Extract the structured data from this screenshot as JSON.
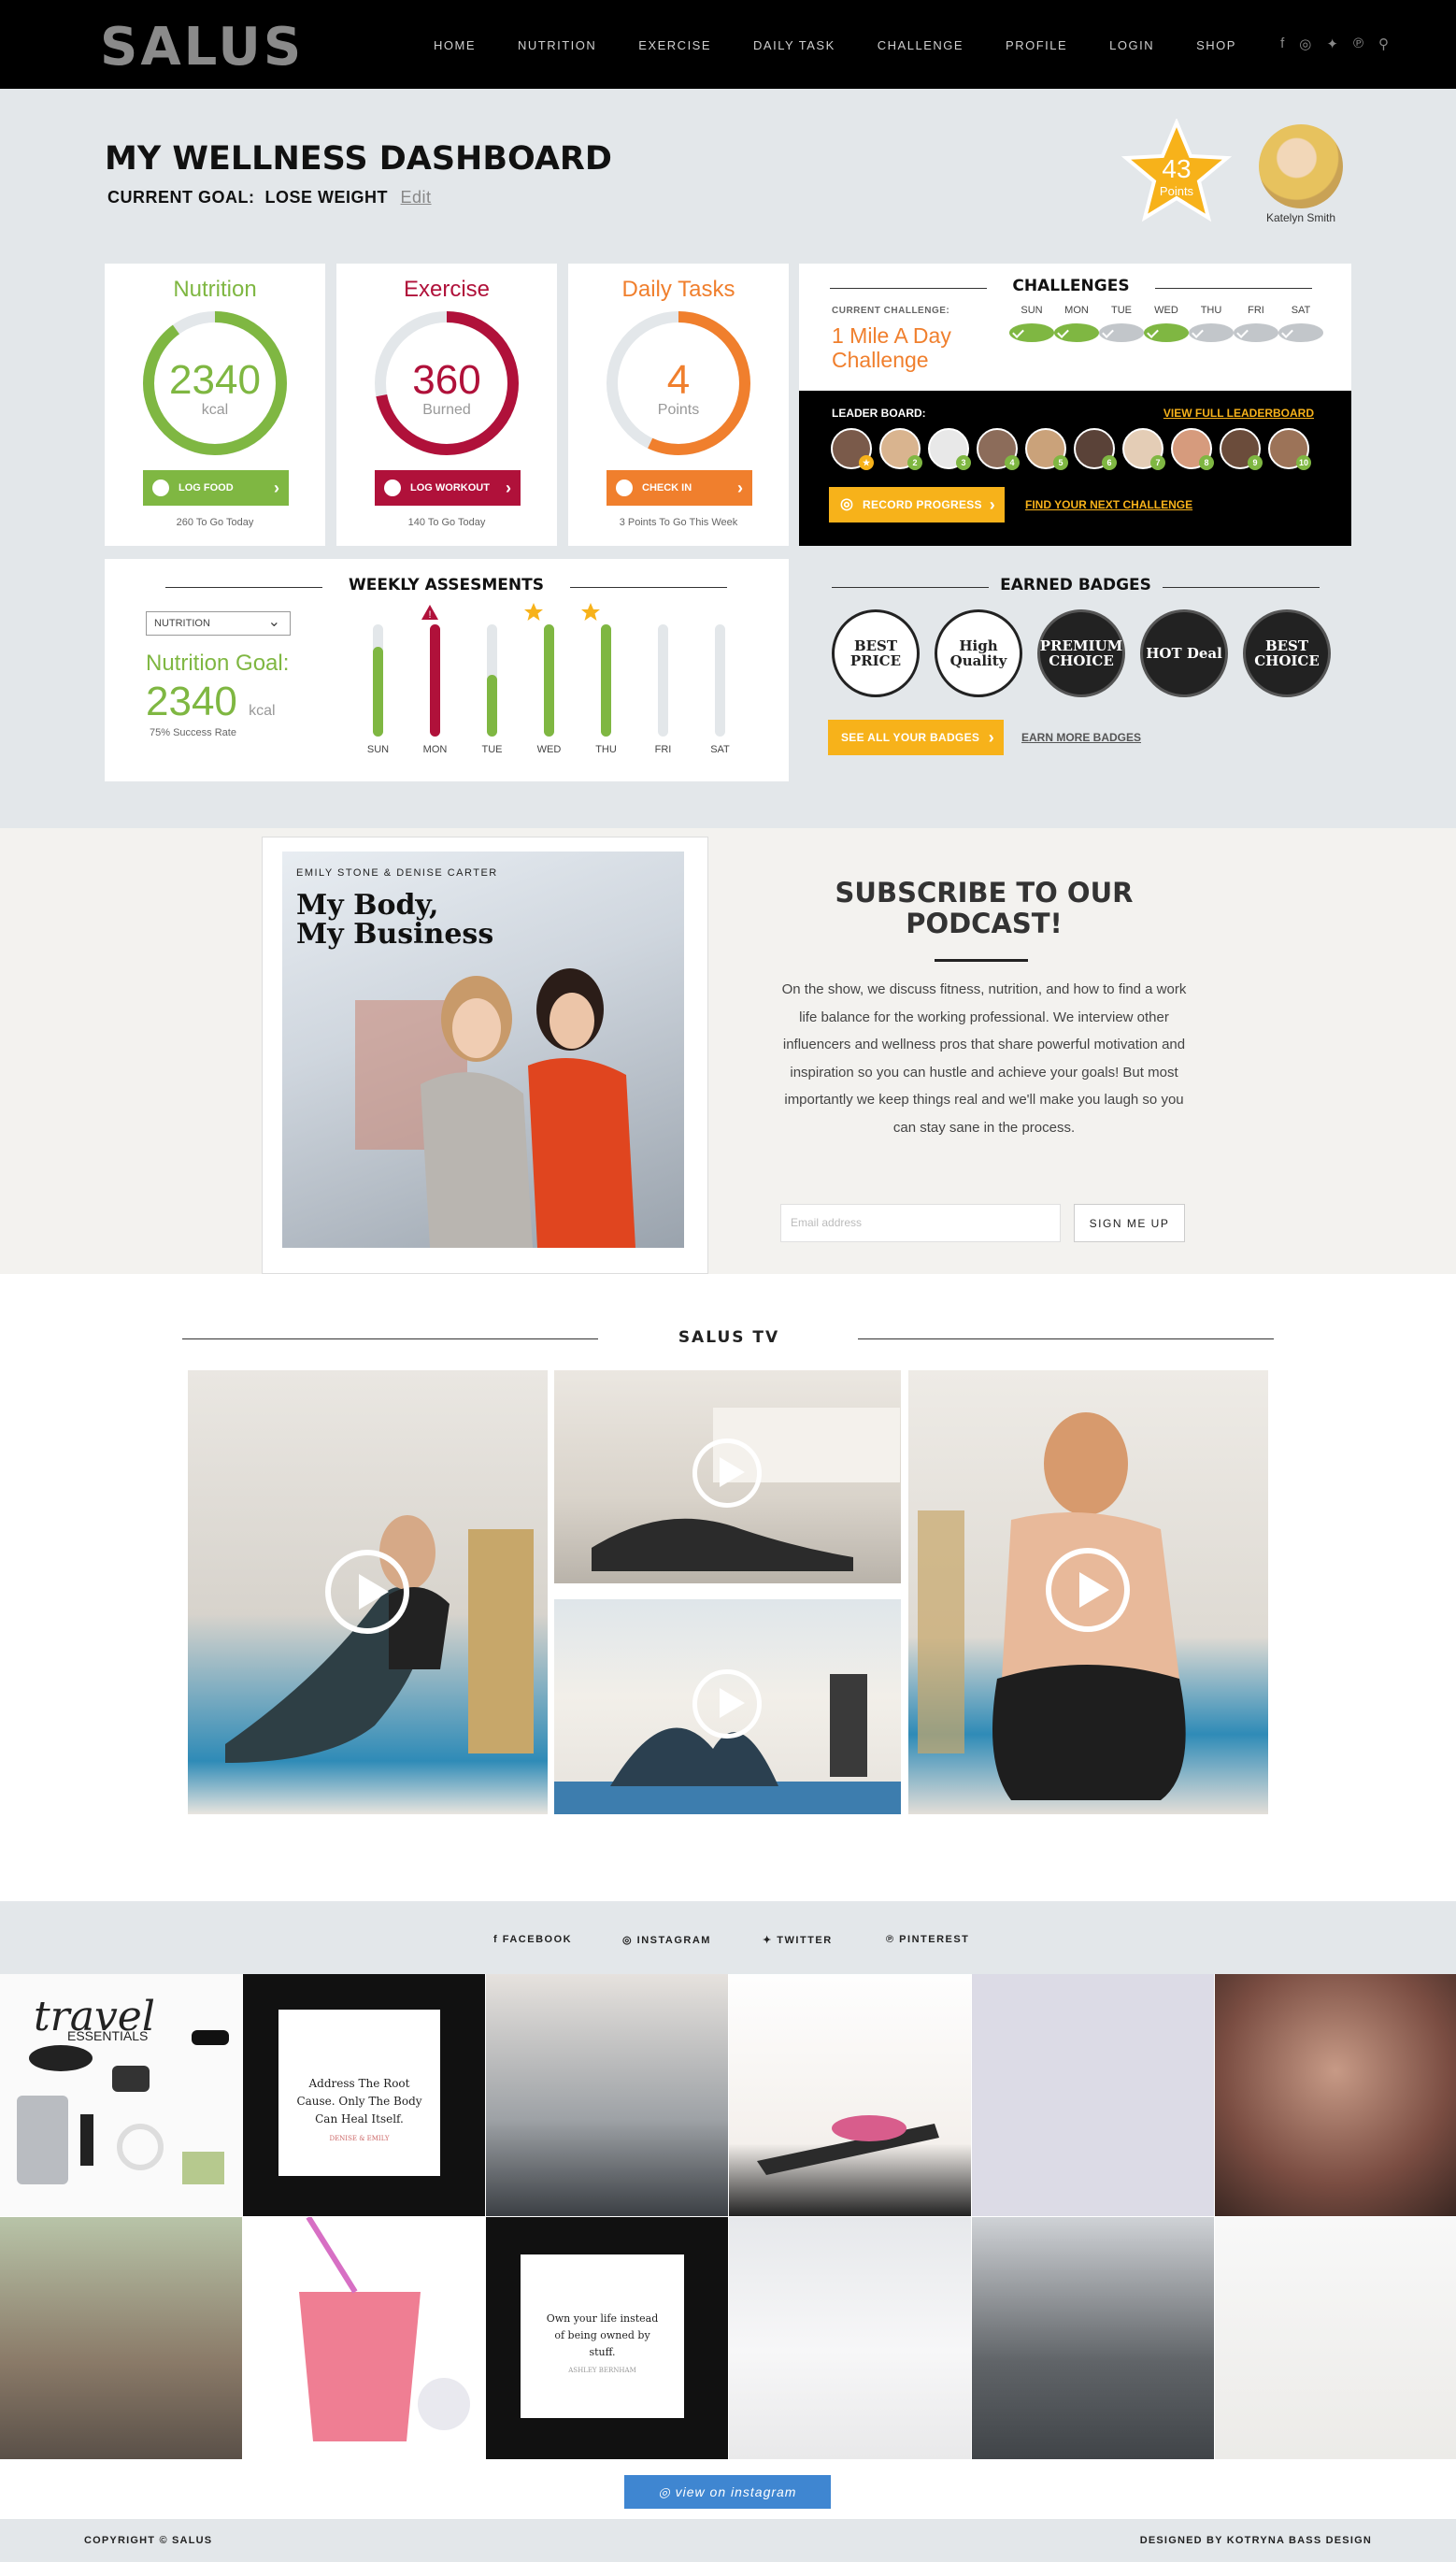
{
  "nav": {
    "logo": "SALUS",
    "links": [
      "HOME",
      "NUTRITION",
      "EXERCISE",
      "DAILY TASK",
      "CHALLENGE",
      "PROFILE",
      "LOGIN",
      "SHOP"
    ],
    "social_icons": [
      "facebook-icon",
      "instagram-icon",
      "twitter-icon",
      "pinterest-icon",
      "search-icon"
    ]
  },
  "dashboard": {
    "title": "MY WELLNESS DASHBOARD",
    "goal_label": "CURRENT GOAL:",
    "goal_value": "LOSE WEIGHT",
    "edit": "Edit",
    "points": {
      "value": "43",
      "label": "Points"
    },
    "user_name": "Katelyn Smith"
  },
  "cards": {
    "nutrition": {
      "title": "Nutrition",
      "value": "2340",
      "unit": "kcal",
      "button": "LOG FOOD",
      "footer": "260 To Go Today",
      "progress": 0.9,
      "color": "#7fb742"
    },
    "exercise": {
      "title": "Exercise",
      "value": "360",
      "unit": "Burned",
      "button": "LOG WORKOUT",
      "footer": "140 To Go Today",
      "progress": 0.72,
      "color": "#b0113a"
    },
    "tasks": {
      "title": "Daily Tasks",
      "value": "4",
      "unit": "Points",
      "button": "CHECK IN",
      "footer": "3 Points To Go This Week",
      "progress": 0.57,
      "color": "#f07f2d"
    }
  },
  "challenges": {
    "heading": "CHALLENGES",
    "current_label": "CURRENT CHALLENGE:",
    "current_name": "1 Mile A Day Challenge",
    "days": [
      "SUN",
      "MON",
      "TUE",
      "WED",
      "THU",
      "FRI",
      "SAT"
    ],
    "completed": [
      true,
      true,
      false,
      true,
      false,
      false,
      false
    ]
  },
  "leaderboard": {
    "label": "LEADER BOARD:",
    "view_all": "VIEW FULL LEADERBOARD",
    "ranks": [
      "",
      "2",
      "3",
      "4",
      "5",
      "6",
      "7",
      "8",
      "9",
      "10"
    ],
    "record_button": "RECORD PROGRESS",
    "next_link": "FIND YOUR NEXT CHALLENGE"
  },
  "weekly": {
    "heading": "WEEKLY ASSESMENTS",
    "select": "NUTRITION",
    "goal_label": "Nutrition Goal:",
    "goal_value": "2340",
    "goal_unit": "kcal",
    "success": "75% Success Rate",
    "days": [
      "SUN",
      "MON",
      "TUE",
      "WED",
      "THU",
      "FRI",
      "SAT"
    ],
    "levels": [
      0.8,
      1.0,
      0.55,
      1.0,
      1.0,
      0,
      0
    ],
    "colors": [
      "#7fb742",
      "#b0113a",
      "#7fb742",
      "#7fb742",
      "#7fb742",
      "#e3e7ea",
      "#e3e7ea"
    ],
    "markers": [
      "",
      "warning-icon",
      "",
      "star-icon",
      "star-icon",
      "",
      ""
    ]
  },
  "badges": {
    "heading": "EARNED BADGES",
    "items": [
      "BEST PRICE",
      "High Quality",
      "PREMIUM CHOICE",
      "HOT Deal",
      "BEST CHOICE"
    ],
    "see_all": "SEE ALL YOUR BADGES",
    "earn_more": "EARN MORE BADGES"
  },
  "podcast": {
    "cover_hosts": "EMILY STONE & DENISE CARTER",
    "cover_title_1": "My Body,",
    "cover_title_2": "My Business",
    "heading": "SUBSCRIBE TO OUR PODCAST!",
    "body": "On the show, we discuss fitness, nutrition, and how to find a work life balance for the working professional. We interview other influencers and wellness pros that share powerful motivation and inspiration so you can hustle and achieve your goals! But most importantly we keep things real and we'll make you laugh so you can stay sane in the process.",
    "email_placeholder": "Email address",
    "signup": "SIGN ME UP"
  },
  "tv": {
    "heading": "SALUS TV"
  },
  "social": {
    "links": [
      "FACEBOOK",
      "INSTAGRAM",
      "TWITTER",
      "PINTEREST"
    ]
  },
  "instagram": {
    "travel_title": "travel",
    "travel_sub": "ESSENTIALS",
    "quote1": "Address The Root Cause. Only The Body Can Heal Itself.",
    "quote1_by": "DENISE & EMILY",
    "quote2": "Own your life instead of being owned by stuff.",
    "quote2_by": "ASHLEY BERNHAM",
    "button": "view on instagram"
  },
  "footer": {
    "copyright": "COPYRIGHT © SALUS",
    "designed": "DESIGNED BY KOTRYNA BASS DESIGN"
  }
}
